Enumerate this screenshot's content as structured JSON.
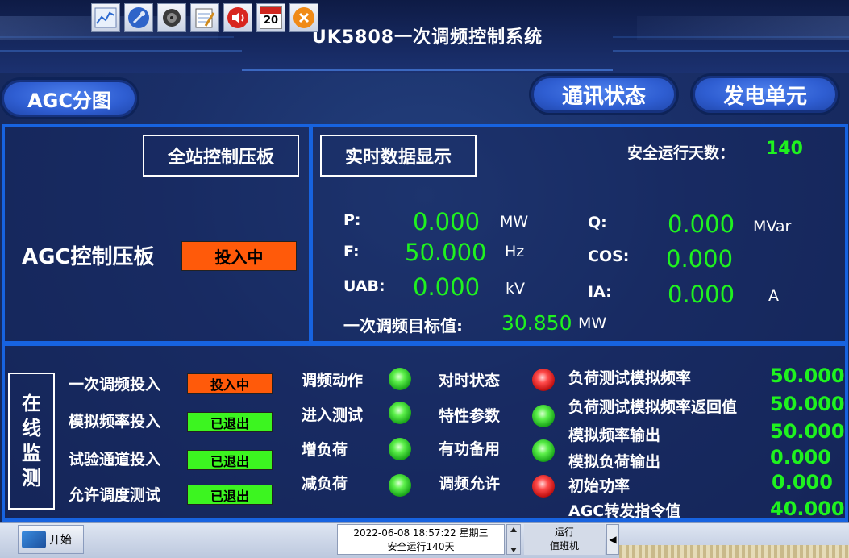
{
  "header": {
    "title": "UK5808一次调频控制系统",
    "agc_button": "AGC分图",
    "comm_button": "通讯状态",
    "gen_button": "发电单元"
  },
  "station_panel": {
    "box_title": "全站控制压板",
    "agc_label": "AGC控制压板",
    "agc_status": "投入中"
  },
  "realtime": {
    "box_title": "实时数据显示",
    "safe_days_label": "安全运行天数：",
    "safe_days_value": "140",
    "p": {
      "label": "P:",
      "value": "0.000",
      "unit": "MW"
    },
    "f": {
      "label": "F:",
      "value": "50.000",
      "unit": "Hz"
    },
    "uab": {
      "label": "UAB:",
      "value": "0.000",
      "unit": "kV"
    },
    "q": {
      "label": "Q:",
      "value": "0.000",
      "unit": "MVar"
    },
    "cos": {
      "label": "COS:",
      "value": "0.000"
    },
    "ia": {
      "label": "IA:",
      "value": "0.000",
      "unit": "A"
    },
    "target": {
      "label": "一次调频目标值:",
      "value": "30.850",
      "unit": "MW"
    }
  },
  "monitor": {
    "vertical_label": [
      "在",
      "线",
      "监",
      "测"
    ],
    "switches": [
      {
        "label": "一次调频投入",
        "status": "投入中",
        "state": "on"
      },
      {
        "label": "模拟频率投入",
        "status": "已退出",
        "state": "off"
      },
      {
        "label": "试验通道投入",
        "status": "已退出",
        "state": "off"
      },
      {
        "label": "允许调度测试",
        "status": "已退出",
        "state": "off"
      }
    ],
    "indicators_left": [
      {
        "label": "调频动作",
        "color": "#3df03d"
      },
      {
        "label": "进入测试",
        "color": "#3df03d"
      },
      {
        "label": "增负荷",
        "color": "#3df03d"
      },
      {
        "label": "减负荷",
        "color": "#3df03d"
      }
    ],
    "indicators_right": [
      {
        "label": "对时状态",
        "color": "#ff3030"
      },
      {
        "label": "特性参数",
        "color": "#3df03d"
      },
      {
        "label": "有功备用",
        "color": "#3df03d"
      },
      {
        "label": "调频允许",
        "color": "#ff3030"
      }
    ],
    "readings": [
      {
        "label": "负荷测试模拟频率",
        "value": "50.000"
      },
      {
        "label": "负荷测试模拟频率返回值",
        "value": "50.000"
      },
      {
        "label": "模拟频率输出",
        "value": "50.000"
      },
      {
        "label": "模拟负荷输出",
        "value": "0.000"
      },
      {
        "label": "初始功率",
        "value": "0.000"
      },
      {
        "label": "AGC转发指令值",
        "value": "40.000"
      }
    ]
  },
  "taskbar": {
    "start_label": "开始",
    "datetime": "2022-06-08 18:57:22 星期三",
    "safe_run": "安全运行140天",
    "run_label": "运行",
    "duty_label": "值班机",
    "calendar_day": "20",
    "arrow": "◀"
  },
  "colors": {
    "accent_green": "#1ff21f",
    "panel_border": "#1763e0",
    "status_on": "#ff5a0a",
    "status_off": "#3cf520"
  }
}
